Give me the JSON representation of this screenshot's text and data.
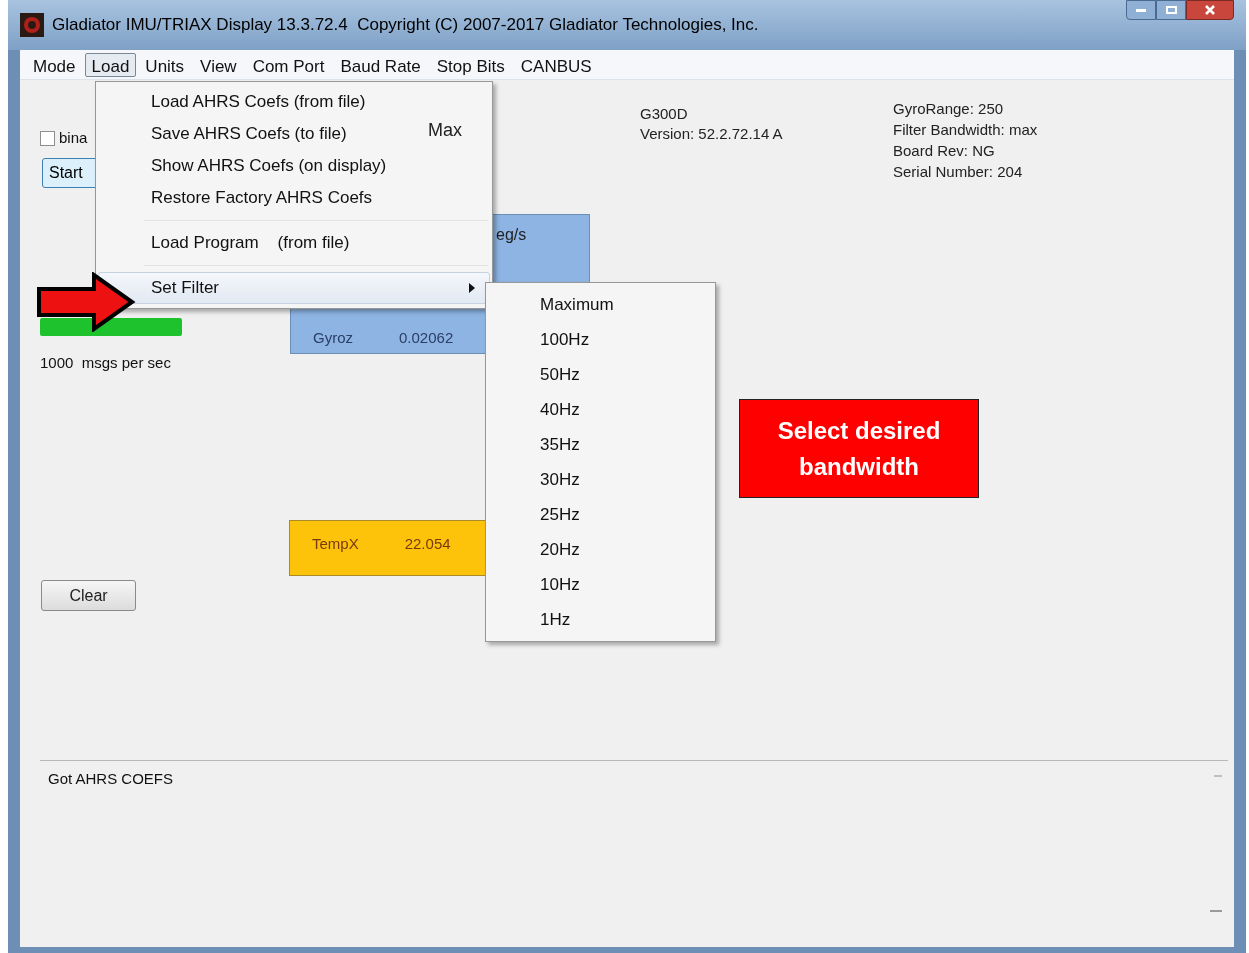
{
  "window": {
    "title": "Gladiator IMU/TRIAX Display 13.3.72.4  Copyright (C) 2007-2017 Gladiator Technologies, Inc."
  },
  "menu_bar": [
    {
      "label": "Mode",
      "selected": false
    },
    {
      "label": "Load",
      "selected": true
    },
    {
      "label": "Units",
      "selected": false
    },
    {
      "label": "View",
      "selected": false
    },
    {
      "label": "Com Port",
      "selected": false
    },
    {
      "label": "Baud Rate",
      "selected": false
    },
    {
      "label": "Stop Bits",
      "selected": false
    },
    {
      "label": "CANBUS",
      "selected": false
    }
  ],
  "load_menu": [
    {
      "label": "Load AHRS Coefs (from file)",
      "selected": false,
      "has_submenu": false,
      "separator_before": false
    },
    {
      "label": "Save AHRS Coefs (to file)",
      "selected": false,
      "has_submenu": false,
      "separator_before": false
    },
    {
      "label": "Show AHRS Coefs (on display)",
      "selected": false,
      "has_submenu": false,
      "separator_before": false
    },
    {
      "label": "Restore Factory AHRS Coefs",
      "selected": false,
      "has_submenu": false,
      "separator_before": false
    },
    {
      "label": "Load Program    (from file)",
      "selected": false,
      "has_submenu": false,
      "separator_before": true
    },
    {
      "label": "Set Filter",
      "selected": true,
      "has_submenu": true,
      "separator_before": true
    }
  ],
  "filter_menu": [
    {
      "label": "Maximum"
    },
    {
      "label": "100Hz"
    },
    {
      "label": "50Hz"
    },
    {
      "label": "40Hz"
    },
    {
      "label": "35Hz"
    },
    {
      "label": "30Hz"
    },
    {
      "label": "25Hz"
    },
    {
      "label": "20Hz"
    },
    {
      "label": "10Hz"
    },
    {
      "label": "1Hz"
    }
  ],
  "binary_checkbox": {
    "label": "bina",
    "checked": false
  },
  "start_button": "Start",
  "max_label": "Max",
  "rate_label": "1000  msgs per sec",
  "clear_button": "Clear",
  "gyro_panel": {
    "unit": "eg/s",
    "rows": [
      {
        "name": "Gyroz",
        "value": "0.02062"
      }
    ]
  },
  "temp_panel": {
    "name": "TempX",
    "value": "22.054"
  },
  "device": {
    "model": "G300D",
    "version": "Version: 52.2.72.14 A"
  },
  "info": [
    "GyroRange: 250",
    "Filter Bandwidth: max",
    "Board Rev: NG",
    "Serial Number: 204"
  ],
  "log": {
    "lines": [
      "Got AHRS COEFS"
    ]
  },
  "annotation": {
    "text": "Select desired bandwidth"
  }
}
